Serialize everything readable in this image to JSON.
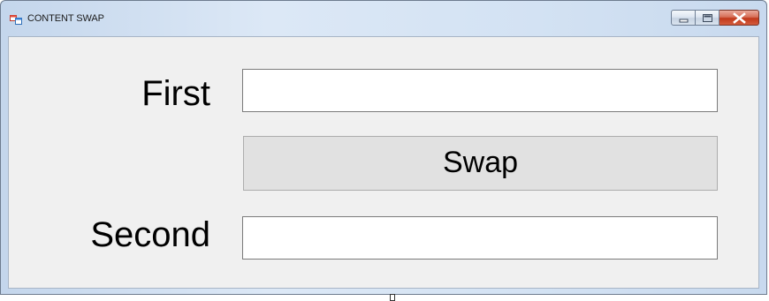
{
  "window": {
    "title": "CONTENT SWAP",
    "icon": "form-icon",
    "controls": {
      "minimize": "minimize-icon",
      "maximize": "maximize-icon",
      "close": "close-icon"
    }
  },
  "form": {
    "first_label": "First",
    "first_value": "",
    "swap_label": "Swap",
    "second_label": "Second",
    "second_value": ""
  },
  "colors": {
    "close_button": "#c8452a",
    "client_background": "#f0f0f0",
    "button_face": "#e1e1e1"
  }
}
